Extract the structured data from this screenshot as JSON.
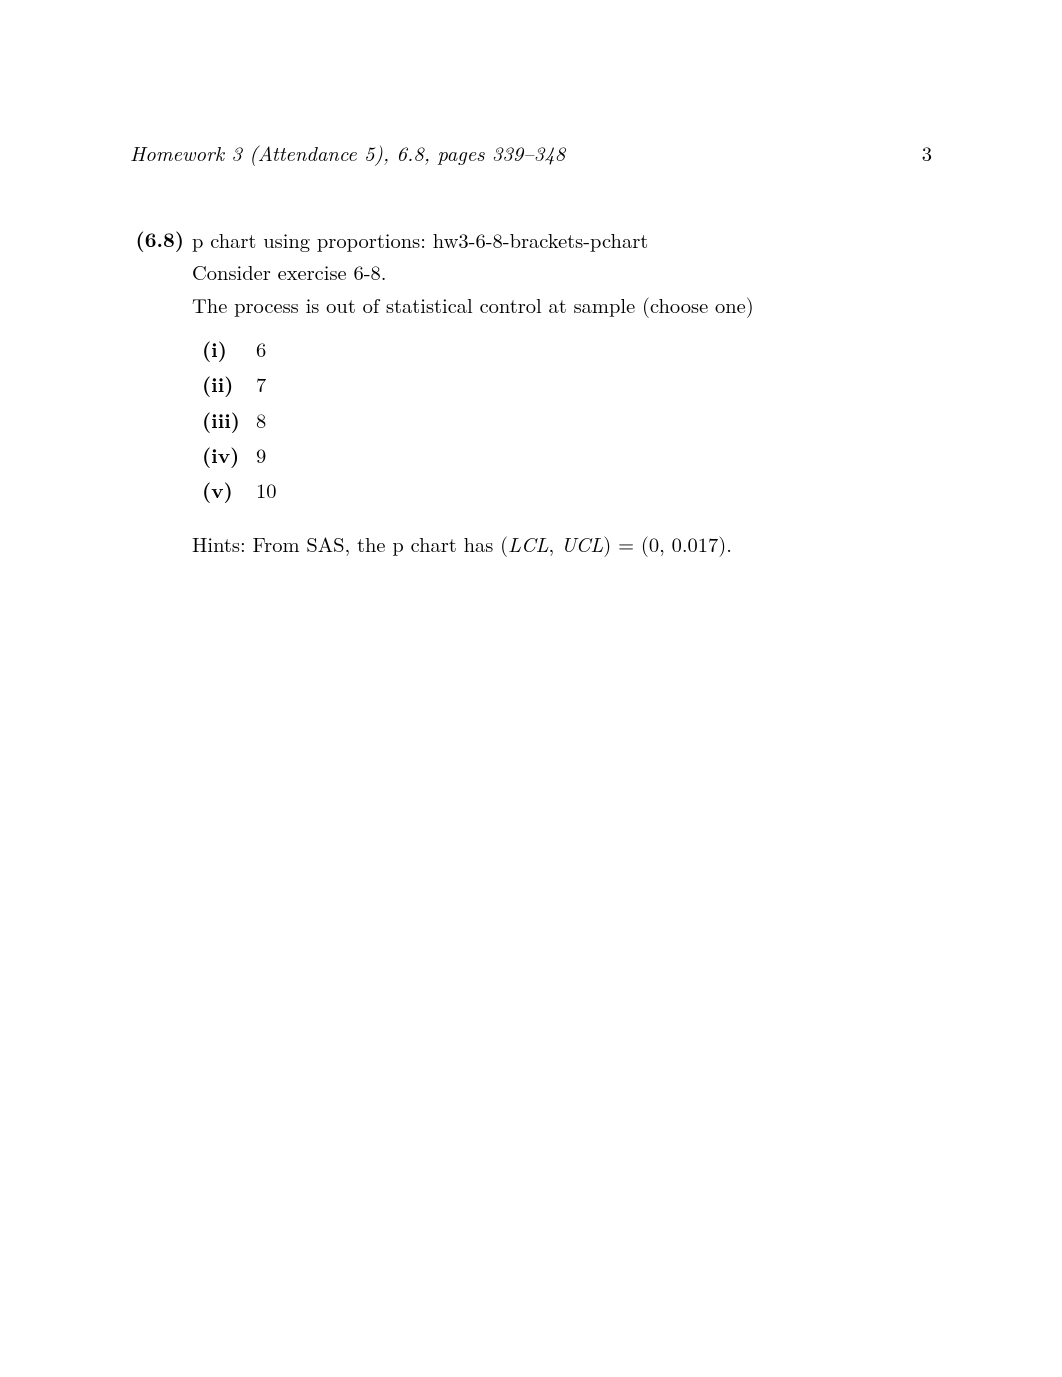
{
  "header": {
    "running_title": "Homework 3 (Attendance 5), 6.8, pages 339–348",
    "page_number": "3"
  },
  "problem": {
    "label": "(6.8)",
    "title": "p chart using proportions: hw3-6-8-brackets-pchart",
    "line2": "Consider exercise 6-8.",
    "line3": "The process is out of statistical control at sample (choose one)",
    "choices": [
      {
        "label": "(i)",
        "value": "6"
      },
      {
        "label": "(ii)",
        "value": "7"
      },
      {
        "label": "(iii)",
        "value": "8"
      },
      {
        "label": "(iv)",
        "value": "9"
      },
      {
        "label": "(v)",
        "value": "10"
      }
    ],
    "hint_prefix": "Hints: From SAS, the p chart has (",
    "hint_lcl": "LCL",
    "hint_comma1": ", ",
    "hint_ucl": "UCL",
    "hint_eq": ") = (0",
    "hint_comma2": ", ",
    "hint_end": "0.017)."
  }
}
